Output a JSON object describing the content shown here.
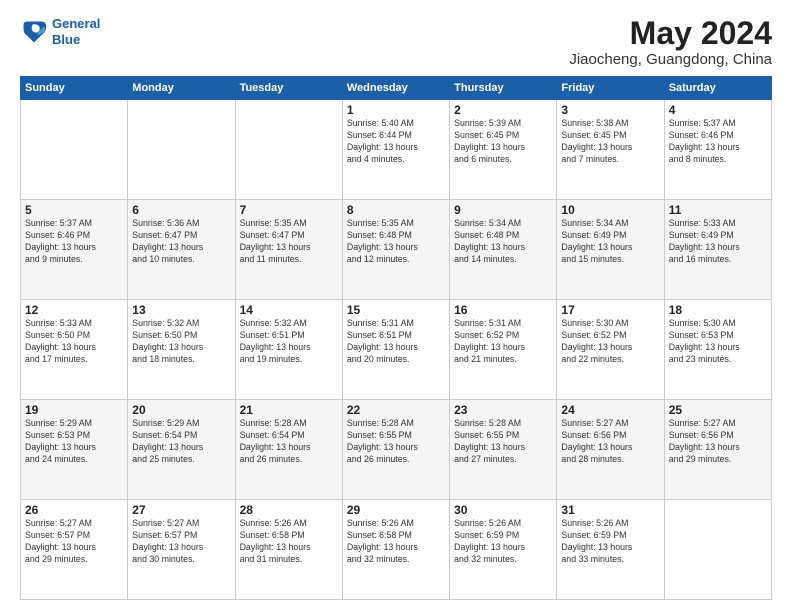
{
  "header": {
    "logo_line1": "General",
    "logo_line2": "Blue",
    "title": "May 2024",
    "subtitle": "Jiaocheng, Guangdong, China"
  },
  "columns": [
    "Sunday",
    "Monday",
    "Tuesday",
    "Wednesday",
    "Thursday",
    "Friday",
    "Saturday"
  ],
  "weeks": [
    [
      {
        "day": "",
        "info": ""
      },
      {
        "day": "",
        "info": ""
      },
      {
        "day": "",
        "info": ""
      },
      {
        "day": "1",
        "info": "Sunrise: 5:40 AM\nSunset: 6:44 PM\nDaylight: 13 hours\nand 4 minutes."
      },
      {
        "day": "2",
        "info": "Sunrise: 5:39 AM\nSunset: 6:45 PM\nDaylight: 13 hours\nand 6 minutes."
      },
      {
        "day": "3",
        "info": "Sunrise: 5:38 AM\nSunset: 6:45 PM\nDaylight: 13 hours\nand 7 minutes."
      },
      {
        "day": "4",
        "info": "Sunrise: 5:37 AM\nSunset: 6:46 PM\nDaylight: 13 hours\nand 8 minutes."
      }
    ],
    [
      {
        "day": "5",
        "info": "Sunrise: 5:37 AM\nSunset: 6:46 PM\nDaylight: 13 hours\nand 9 minutes."
      },
      {
        "day": "6",
        "info": "Sunrise: 5:36 AM\nSunset: 6:47 PM\nDaylight: 13 hours\nand 10 minutes."
      },
      {
        "day": "7",
        "info": "Sunrise: 5:35 AM\nSunset: 6:47 PM\nDaylight: 13 hours\nand 11 minutes."
      },
      {
        "day": "8",
        "info": "Sunrise: 5:35 AM\nSunset: 6:48 PM\nDaylight: 13 hours\nand 12 minutes."
      },
      {
        "day": "9",
        "info": "Sunrise: 5:34 AM\nSunset: 6:48 PM\nDaylight: 13 hours\nand 14 minutes."
      },
      {
        "day": "10",
        "info": "Sunrise: 5:34 AM\nSunset: 6:49 PM\nDaylight: 13 hours\nand 15 minutes."
      },
      {
        "day": "11",
        "info": "Sunrise: 5:33 AM\nSunset: 6:49 PM\nDaylight: 13 hours\nand 16 minutes."
      }
    ],
    [
      {
        "day": "12",
        "info": "Sunrise: 5:33 AM\nSunset: 6:50 PM\nDaylight: 13 hours\nand 17 minutes."
      },
      {
        "day": "13",
        "info": "Sunrise: 5:32 AM\nSunset: 6:50 PM\nDaylight: 13 hours\nand 18 minutes."
      },
      {
        "day": "14",
        "info": "Sunrise: 5:32 AM\nSunset: 6:51 PM\nDaylight: 13 hours\nand 19 minutes."
      },
      {
        "day": "15",
        "info": "Sunrise: 5:31 AM\nSunset: 6:51 PM\nDaylight: 13 hours\nand 20 minutes."
      },
      {
        "day": "16",
        "info": "Sunrise: 5:31 AM\nSunset: 6:52 PM\nDaylight: 13 hours\nand 21 minutes."
      },
      {
        "day": "17",
        "info": "Sunrise: 5:30 AM\nSunset: 6:52 PM\nDaylight: 13 hours\nand 22 minutes."
      },
      {
        "day": "18",
        "info": "Sunrise: 5:30 AM\nSunset: 6:53 PM\nDaylight: 13 hours\nand 23 minutes."
      }
    ],
    [
      {
        "day": "19",
        "info": "Sunrise: 5:29 AM\nSunset: 6:53 PM\nDaylight: 13 hours\nand 24 minutes."
      },
      {
        "day": "20",
        "info": "Sunrise: 5:29 AM\nSunset: 6:54 PM\nDaylight: 13 hours\nand 25 minutes."
      },
      {
        "day": "21",
        "info": "Sunrise: 5:28 AM\nSunset: 6:54 PM\nDaylight: 13 hours\nand 26 minutes."
      },
      {
        "day": "22",
        "info": "Sunrise: 5:28 AM\nSunset: 6:55 PM\nDaylight: 13 hours\nand 26 minutes."
      },
      {
        "day": "23",
        "info": "Sunrise: 5:28 AM\nSunset: 6:55 PM\nDaylight: 13 hours\nand 27 minutes."
      },
      {
        "day": "24",
        "info": "Sunrise: 5:27 AM\nSunset: 6:56 PM\nDaylight: 13 hours\nand 28 minutes."
      },
      {
        "day": "25",
        "info": "Sunrise: 5:27 AM\nSunset: 6:56 PM\nDaylight: 13 hours\nand 29 minutes."
      }
    ],
    [
      {
        "day": "26",
        "info": "Sunrise: 5:27 AM\nSunset: 6:57 PM\nDaylight: 13 hours\nand 29 minutes."
      },
      {
        "day": "27",
        "info": "Sunrise: 5:27 AM\nSunset: 6:57 PM\nDaylight: 13 hours\nand 30 minutes."
      },
      {
        "day": "28",
        "info": "Sunrise: 5:26 AM\nSunset: 6:58 PM\nDaylight: 13 hours\nand 31 minutes."
      },
      {
        "day": "29",
        "info": "Sunrise: 5:26 AM\nSunset: 6:58 PM\nDaylight: 13 hours\nand 32 minutes."
      },
      {
        "day": "30",
        "info": "Sunrise: 5:26 AM\nSunset: 6:59 PM\nDaylight: 13 hours\nand 32 minutes."
      },
      {
        "day": "31",
        "info": "Sunrise: 5:26 AM\nSunset: 6:59 PM\nDaylight: 13 hours\nand 33 minutes."
      },
      {
        "day": "",
        "info": ""
      }
    ]
  ]
}
